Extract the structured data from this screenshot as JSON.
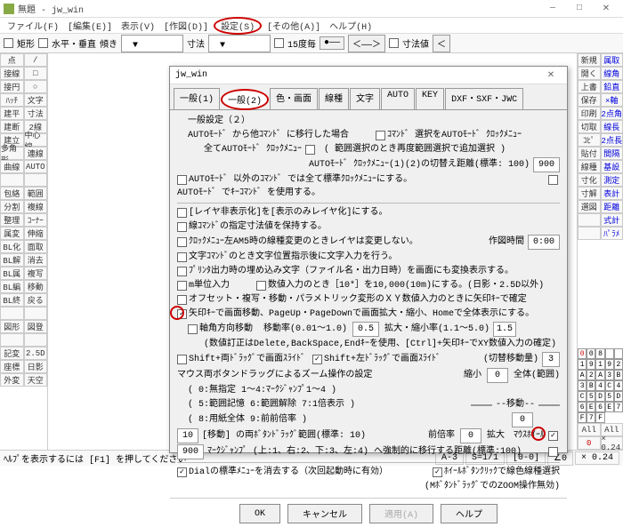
{
  "title": "無題 - jw_win",
  "menu": [
    "ファイル(F)",
    "[編集(E)]",
    "表示(V)",
    "[作図(D)]",
    "設定(S)",
    "[その他(A)]",
    "ヘルプ(H)"
  ],
  "toolbar": {
    "rect": "矩形",
    "hv": "水平・垂直",
    "angle_label": "傾き",
    "size_label": "寸法",
    "deg15": "15度毎",
    "dimval": "寸法値"
  },
  "left_tools_1": [
    "点",
    "接線",
    "接円",
    "ﾊｯﾁ",
    "建平",
    "建断",
    "建立",
    "多角形",
    "曲線",
    "",
    "包絡",
    "分割",
    "整理",
    "属変",
    "BL化",
    "BL解",
    "BL属",
    "BL編",
    "BL終",
    "",
    "図形",
    "",
    "記変",
    "座標",
    "外変"
  ],
  "left_tools_2": [
    "/",
    "□",
    "○",
    "文字",
    "寸法",
    "2線",
    "中心線",
    "連線",
    "AUTO",
    "",
    "範囲",
    "複線",
    "ｺｰﾅｰ",
    "伸縮",
    "面取",
    "消去",
    "複写",
    "移動",
    "戻る",
    "",
    "図登",
    "",
    "2.5D",
    "日影",
    "天空"
  ],
  "right_tools": [
    [
      "新規",
      "属取"
    ],
    [
      "開く",
      "線角"
    ],
    [
      "上書",
      "鉛直"
    ],
    [
      "保存",
      "×軸"
    ],
    [
      "印刷",
      "2点角"
    ],
    [
      "切取",
      "線長"
    ],
    [
      "ｺﾋﾟ",
      "2点長"
    ],
    [
      "貼付",
      "間隔"
    ],
    [
      "線種",
      "基設"
    ],
    [
      "寸化",
      "測定"
    ],
    [
      "寸解",
      "表計"
    ],
    [
      "選図",
      "距離"
    ],
    [
      "",
      "式計"
    ],
    [
      "",
      "ﾊﾟﾗﾒ"
    ]
  ],
  "numpad": {
    "row1": [
      "0",
      "8"
    ],
    "grid": [
      "1",
      "9",
      "1",
      "9",
      "2",
      "A",
      "2",
      "A",
      "3",
      "B",
      "3",
      "B",
      "4",
      "C",
      "4",
      "C",
      "5",
      "D",
      "5",
      "D",
      "6",
      "E",
      "6",
      "E",
      "7",
      "F",
      "7",
      "F"
    ],
    "all": "All",
    "zero": "0"
  },
  "status": {
    "help": "ﾍﾙﾌﾟを表示するには [F1] を押してください",
    "a3": "A-3",
    "s1": "S=1/1",
    "ang0": "[0-0]",
    "ang": "∠0",
    "x024": "× 0.24"
  },
  "dialog": {
    "title": "jw_win",
    "tabs": [
      "一般(1)",
      "一般(2)",
      "色・画面",
      "線種",
      "文字",
      "AUTO",
      "KEY",
      "DXF・SXF・JWC"
    ],
    "section_title": "一般設定（２）",
    "l1": "AUTOﾓｰﾄﾞ から他ｺﾏﾝﾄﾞ に移行した場合",
    "l1a": "ｺﾏﾝﾄﾞ 選択をAUTOﾓｰﾄﾞ ｸﾛｯｸﾒﾆｭｰ",
    "l2": "全てAUTOﾓｰﾄﾞ ｸﾛｯｸﾒﾆｭｰ",
    "l2a": "( 範囲選択のとき再度範囲選択で追加選択 )",
    "l3": "AUTOﾓｰﾄﾞ ｸﾛｯｸﾒﾆｭｰ(1)(2)の切替え距離(標準: 100)",
    "l3v": "900",
    "l4": "AUTOﾓｰﾄﾞ 以外のｺﾏﾝﾄﾞ では全て標準ｸﾛｯｸﾒﾆｭｰにする。",
    "l4a": "AUTOﾓｰﾄﾞ でｷｰｺﾏﾝﾄﾞ を使用する。",
    "l5": "[レイヤ非表示化]を[表示のみレイヤ化]にする。",
    "l6": "線ｺﾏﾝﾄﾞの指定寸法値を保持する。",
    "l7": "ｸﾛｯｸﾒﾆｭｰ左AM5時の線種変更のときレイヤは変更しない。",
    "l7a": "作図時間",
    "l7v": "0:00",
    "l8": "文字ｺﾏﾝﾄﾞのとき文字位置指示後に文字入力を行う。",
    "l9": "ﾌﾟﾘﾝﾀ出力時の埋め込み文字（ファイル名・出力日時）を画面にも変換表示する。",
    "l10": "m単位入力",
    "l10a": "数値入力のとき［10*］を10,000(10m)にする。(日影・2.5D以外)",
    "l11": "オフセット・複写・移動・パラメトリック変形のＸＹ数値入力のときに矢印ｷｰで確定",
    "l12": "矢印ｷｰで画面移動、PageUp・PageDownで画面拡大・縮小、Homeで全体表示にする。",
    "l13": "軸角方向移動",
    "l13a": "移動率(0.01～1.0)",
    "l13v": "0.5",
    "l13b": "拡大・縮小率(1.1～5.0)",
    "l13c": "1.5",
    "l14": "(数値訂正はDelete,BackSpace,Endｷｰを使用、[Ctrl]+矢印ｷｰでXY数値入力の確定)",
    "l15": "Shift+両ﾄﾞﾗｯｸﾞで画面ｽﾗｲﾄﾞ",
    "l15a": "Shift+左ﾄﾞﾗｯｸﾞで画面ｽﾗｲﾄﾞ",
    "l15b": "(切替移動量)",
    "l15v": "3",
    "l16": "マウス両ボタンドラッグによるズーム操作の設定",
    "l16a": "縮小",
    "l16v": "0",
    "l16b": "全体(範囲)",
    "l17": "( 0:無指定  1～4:ﾏｰｸｼﾞｬﾝﾌﾟ1～4 )",
    "l18": "( 5:範囲記憶  6:範囲解除  7:1倍表示 )",
    "l18a": "--移動--",
    "l19": "( 8:用紙全体  9:前前倍率 )",
    "l20v": "10",
    "l20": "[移動] の両ﾎﾞﾀﾝﾄﾞﾗｯｸﾞ範囲(標準: 10)",
    "l20a": "前倍率",
    "l20b": "0",
    "l20c": "拡大",
    "l20d": "ﾏｳｽﾎｲｰﾙ",
    "l21v": "900",
    "l21": "ﾏｰｸｼﾞｬﾝﾌﾟ (上:1、右:2、下:3、左:4) へ強制的に移行する距離(標準:100)",
    "l22": "Dialの標準ﾒﾆｭｰを消去する（次回起動時に有効）",
    "l22a": "ﾎｲｰﾙﾎﾞﾀﾝｸﾘｯｸで線色線種選択",
    "l22b": "(MﾎﾞﾀﾝﾄﾞﾗｯｸﾞでのZOOM操作無効)",
    "btns": [
      "OK",
      "キャンセル",
      "適用(A)",
      "ヘルプ"
    ]
  }
}
